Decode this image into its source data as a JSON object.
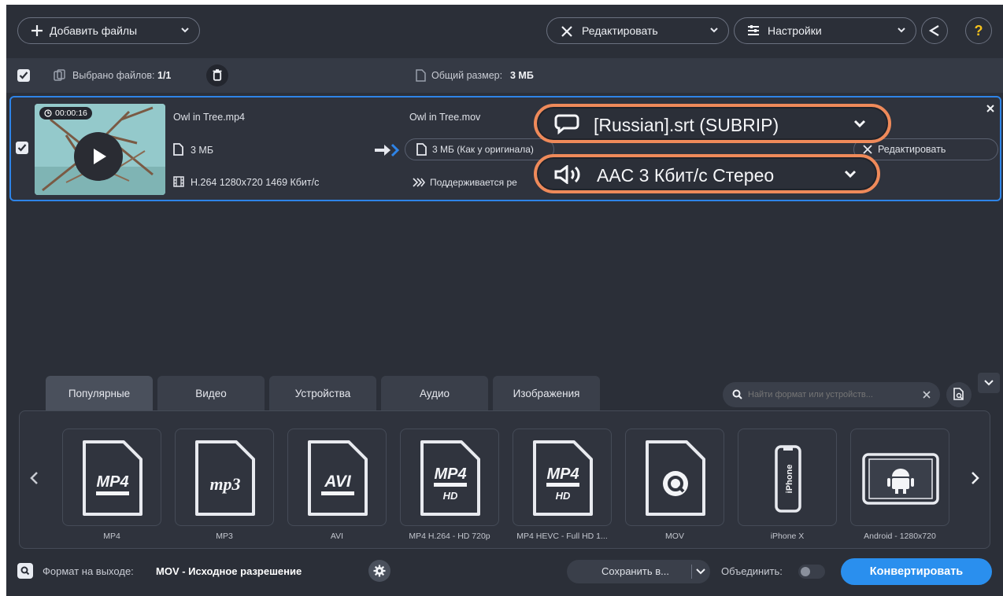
{
  "toolbar": {
    "add_files": "Добавить файлы",
    "edit": "Редактировать",
    "settings": "Настройки",
    "help": "?"
  },
  "selection": {
    "selected_label": "Выбрано файлов:",
    "selected_value": "1/1",
    "total_label": "Общий размер:",
    "total_value": "3 МБ"
  },
  "file": {
    "duration": "00:00:16",
    "input_name": "Owl in Tree.mp4",
    "input_size": "3 МБ",
    "input_codec": "H.264 1280x720 1469 Кбит/с",
    "output_name": "Owl in Tree.mov",
    "output_size": "3 МБ (Как у оригинала)",
    "supported": "Поддерживается ре",
    "edit": "Редактировать",
    "subtitle_track": "[Russian].srt (SUBRIP)",
    "audio_track": "AAC 3 Кбит/с Стерео"
  },
  "tabs": [
    {
      "label": "Популярные"
    },
    {
      "label": "Видео"
    },
    {
      "label": "Устройства"
    },
    {
      "label": "Аудио"
    },
    {
      "label": "Изображения"
    }
  ],
  "search": {
    "placeholder": "Найти формат или устройств..."
  },
  "formats": [
    {
      "label": "MP4",
      "badge": "MP4"
    },
    {
      "label": "MP3",
      "badge": "mp3"
    },
    {
      "label": "AVI",
      "badge": "AVI"
    },
    {
      "label": "MP4 H.264 - HD 720p",
      "badge": "MP4",
      "sub": "HD"
    },
    {
      "label": "MP4 HEVC - Full HD 1...",
      "badge": "MP4",
      "sub": "HD"
    },
    {
      "label": "MOV",
      "badge": ""
    },
    {
      "label": "iPhone X",
      "badge": "iPhone"
    },
    {
      "label": "Android - 1280x720",
      "badge": ""
    }
  ],
  "footer": {
    "format_label": "Формат на выходе:",
    "format_value": "MOV - Исходное разрешение",
    "save_to": "Сохранить в...",
    "merge": "Объединить:",
    "convert": "Конвертировать"
  },
  "colors": {
    "accent": "#2e84e8",
    "callout": "#ef8a5a",
    "background": "#2b2f38"
  }
}
